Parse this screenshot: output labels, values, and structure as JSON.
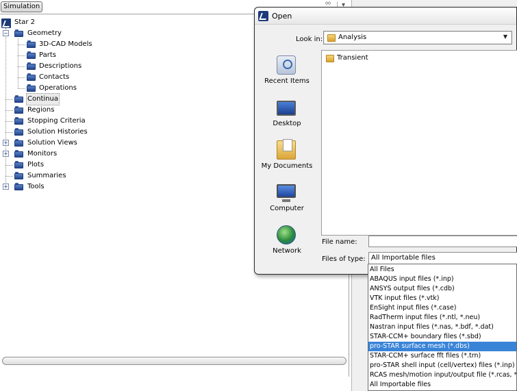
{
  "simulation_pane": {
    "tab_label": "Simulation",
    "tree": {
      "root": "Star 2",
      "geometry": {
        "label": "Geometry",
        "children": [
          "3D-CAD Models",
          "Parts",
          "Descriptions",
          "Contacts",
          "Operations"
        ]
      },
      "nodes": [
        "Continua",
        "Regions",
        "Stopping Criteria",
        "Solution Histories",
        "Solution Views",
        "Monitors",
        "Plots",
        "Summaries",
        "Tools"
      ],
      "selected": "Continua"
    }
  },
  "open_dialog": {
    "title": "Open",
    "look_in_label": "Look in:",
    "look_in_value": "Analysis",
    "places": [
      "Recent Items",
      "Desktop",
      "My Documents",
      "Computer",
      "Network"
    ],
    "files": [
      "Transient"
    ],
    "file_name_label": "File name:",
    "file_name_value": "",
    "files_of_type_label": "Files of type:",
    "files_of_type_value": "All Importable files"
  },
  "file_type_options": [
    "All Files",
    "ABAQUS input files (*.inp)",
    "ANSYS output files (*.cdb)",
    "VTK input files (*.vtk)",
    "EnSight input files (*.case)",
    "RadTherm input files (*.ntl, *.neu)",
    "Nastran input files (*.nas, *.bdf, *.dat)",
    "STAR-CCM+ boundary files (*.sbd)",
    "pro-STAR surface mesh (*.dbs)",
    "STAR-CCM+ surface fft files (*.trn)",
    "pro-STAR shell input (cell/vertex) files (*.inp)",
    "RCAS mesh/motion input/output file (*.rcas, *.in)",
    "All Importable files"
  ],
  "highlighted_option_index": 8,
  "colors": {
    "selection": "#3a84d8",
    "folder_blue": "#23468f",
    "folder_yellow": "#d9a42f"
  }
}
